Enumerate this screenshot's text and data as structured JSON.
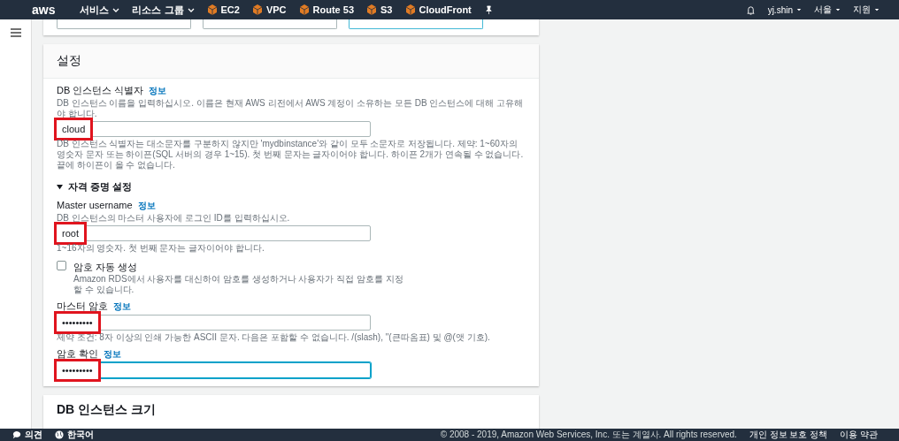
{
  "nav": {
    "logo": "aws",
    "menus": [
      {
        "label": "서비스"
      },
      {
        "label": "리소스 그룹"
      }
    ],
    "shortcuts": [
      {
        "label": "EC2"
      },
      {
        "label": "VPC"
      },
      {
        "label": "Route 53"
      },
      {
        "label": "S3"
      },
      {
        "label": "CloudFront"
      }
    ],
    "user_menus": [
      {
        "label": "yj.shin"
      },
      {
        "label": "서울"
      },
      {
        "label": "지원"
      }
    ]
  },
  "settings": {
    "title": "설정",
    "fields": [
      {
        "kind": "text",
        "label": "DB 인스턴스 식별자",
        "info": "정보",
        "description": "DB 인스턴스 이름을 입력하십시오. 이름은 현재 AWS 리전에서 AWS 계정이 소유하는 모든 DB 인스턴스에 대해 고유해야 합니다.",
        "value": "cloud",
        "highlighted": true,
        "focused": false,
        "constraint": "DB 인스턴스 식별자는 대소문자를 구분하지 않지만 'mydbinstance'와 같이 모두 소문자로 저장됩니다. 제약: 1~60자의 영숫자 문자 또는 하이픈(SQL 서버의 경우 1~15). 첫 번째 문자는 글자이어야 합니다. 하이픈 2개가 연속될 수 없습니다. 끝에 하이픈이 올 수 없습니다."
      },
      {
        "kind": "section",
        "label": "자격 증명 설정",
        "expanded": true
      },
      {
        "kind": "text",
        "label": "Master username",
        "info": "정보",
        "description": "DB 인스턴스의 마스터 사용자에 로그인 ID를 입력하십시오.",
        "value": "root",
        "highlighted": true,
        "focused": false,
        "constraint": "1~16자의 영숫자. 첫 번째 문자는 글자이어야 합니다."
      },
      {
        "kind": "checkbox",
        "label": "암호 자동 생성",
        "checked": false,
        "description": "Amazon RDS에서 사용자를 대신하여 암호를 생성하거나 사용자가 직접 암호를 지정할 수 있습니다."
      },
      {
        "kind": "text",
        "label": "마스터 암호",
        "info": "정보",
        "value": "•••••••••",
        "highlighted": true,
        "focused": false,
        "constraint": "제약 조건: 8자 이상의 인쇄 가능한 ASCII 문자. 다음은 포함할 수 없습니다. /(slash), \"(큰따옴표) 및 @(앳 기호)."
      },
      {
        "kind": "text",
        "label": "암호 확인",
        "info": "정보",
        "value": "•••••••••",
        "highlighted": true,
        "focused": true
      }
    ]
  },
  "next_card": {
    "title": "DB 인스턴스 크기"
  },
  "footer": {
    "feedback": "의견",
    "language": "한국어",
    "copyright": "© 2008 - 2019, Amazon Web Services, Inc. 또는 계열사. All rights reserved.",
    "links": [
      "개인 정보 보호 정책",
      "이용 약관"
    ]
  }
}
